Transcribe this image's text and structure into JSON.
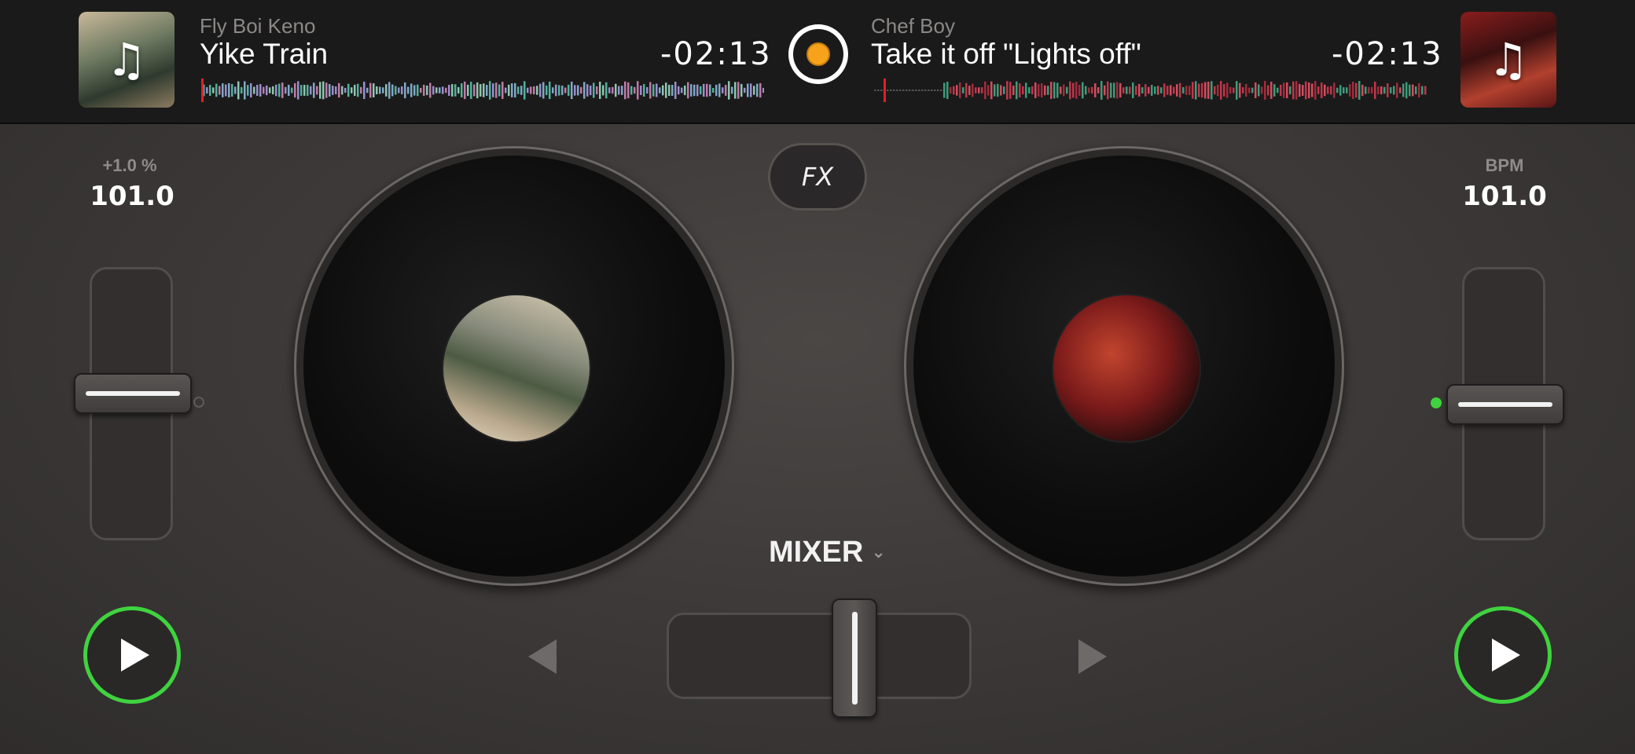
{
  "deck_a": {
    "artist": "Fly Boi Keno",
    "title": "Yike Train",
    "time_remaining": "-02:13",
    "pitch_percent": "+1.0 %",
    "bpm_value": "101.0",
    "play_icon": "play-icon",
    "artwork_icon": "music-note-icon"
  },
  "deck_b": {
    "artist": "Chef Boy",
    "title": "Take it off \"Lights off\"",
    "time_remaining": "-02:13",
    "bpm_label": "BPM",
    "bpm_value": "101.0",
    "play_icon": "play-icon",
    "artwork_icon": "music-note-icon"
  },
  "fx": {
    "label": "FX"
  },
  "mixer": {
    "label": "MIXER",
    "chevron": "⌄"
  },
  "symbols": {
    "music_note": "♫"
  },
  "colors": {
    "accent_green": "#3fd33f",
    "logo_orange": "#f7a21b",
    "playhead_red": "#e0202a"
  }
}
